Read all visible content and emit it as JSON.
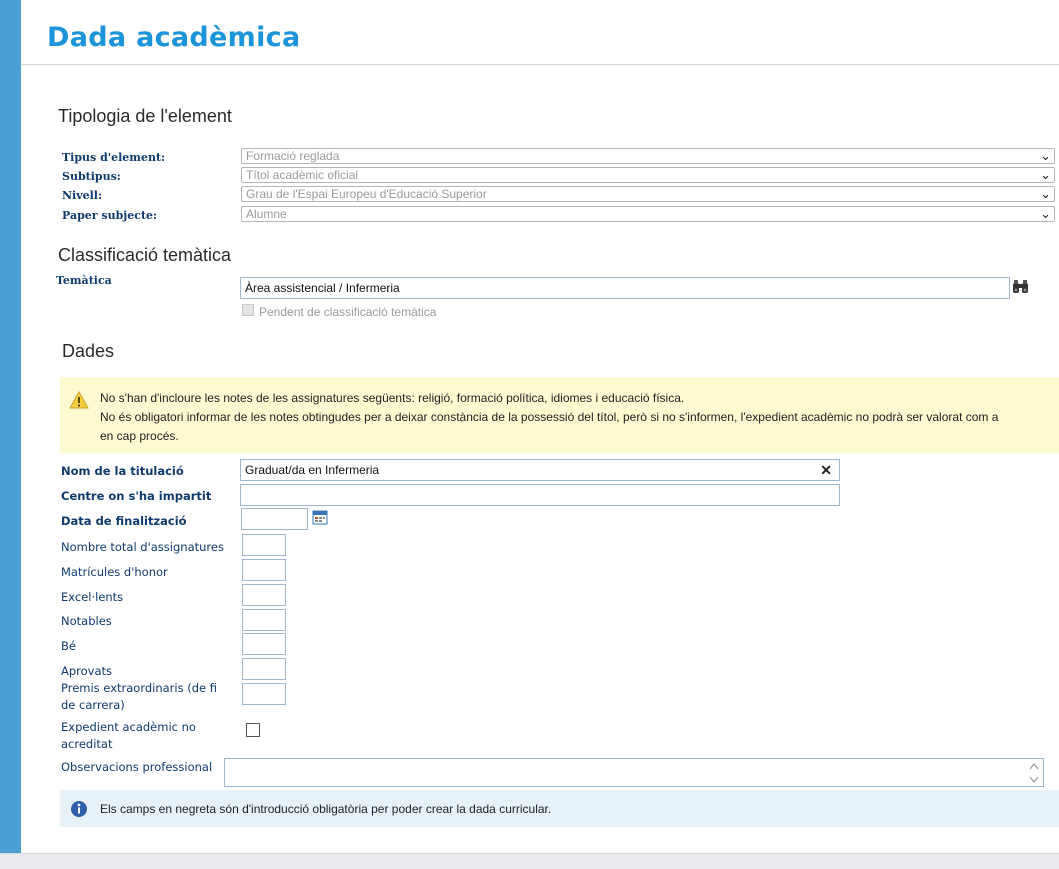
{
  "page": {
    "title": "Dada acadèmica"
  },
  "sections": {
    "tipologia": "Tipologia de l'element",
    "classificacio": "Classificació temàtica",
    "dades": "Dades"
  },
  "tipologia": {
    "tipus_label": "Tipus d'element:",
    "tipus_value": "Formació reglada",
    "subtipus_label": "Subtipus:",
    "subtipus_value": "Títol acadèmic oficial",
    "nivell_label": "Nivell:",
    "nivell_value": "Grau de l'Espai Europeu d'Educació Superior",
    "paper_label": "Paper subjecte:",
    "paper_value": "Alumne"
  },
  "classificacio": {
    "tematica_label": "Temàtica",
    "tematica_value": "Àrea assistencial / Infermeria",
    "pendent_label": "Pendent de classificació temàtica"
  },
  "warning": {
    "line1": "No s'han d'incloure les notes de les assignatures següents: religió, formació política, idiomes i educació física.",
    "line2": "No és obligatori informar de les notes obtingudes per a deixar constància de la possessió del títol, però si no s'informen, l'expedient acadèmic no podrà ser valorat com a",
    "line3": "en cap procés."
  },
  "dades": {
    "nom_label": "Nom de la titulació",
    "nom_value": "Graduat/da en Infermeria",
    "centre_label": "Centre on s'ha impartit",
    "data_label": "Data de finalització",
    "total_label": "Nombre total d'assignatures",
    "matricules_label": "Matrícules d'honor",
    "excellents_label": "Excel·lents",
    "notables_label": "Notables",
    "be_label": "Bé",
    "aprovats_label": "Aprovats",
    "premis_label": "Premis extraordinaris (de fi de carrera)",
    "expedient_label": "Expedient acadèmic no acreditat",
    "observacions_label": "Observacions professional"
  },
  "info": {
    "text": "Els camps en negreta són d'introducció obligatòria per poder crear la dada curricular."
  },
  "colors": {
    "accent": "#1c94d9",
    "sidebar": "#4a9fd2",
    "warning_bg": "#fdf9d1",
    "info_bg": "#e6f2f8"
  },
  "icons": {
    "search": "binoculars-icon",
    "calendar": "calendar-icon",
    "warning": "warning-icon",
    "info": "info-icon",
    "clear": "close-icon"
  }
}
